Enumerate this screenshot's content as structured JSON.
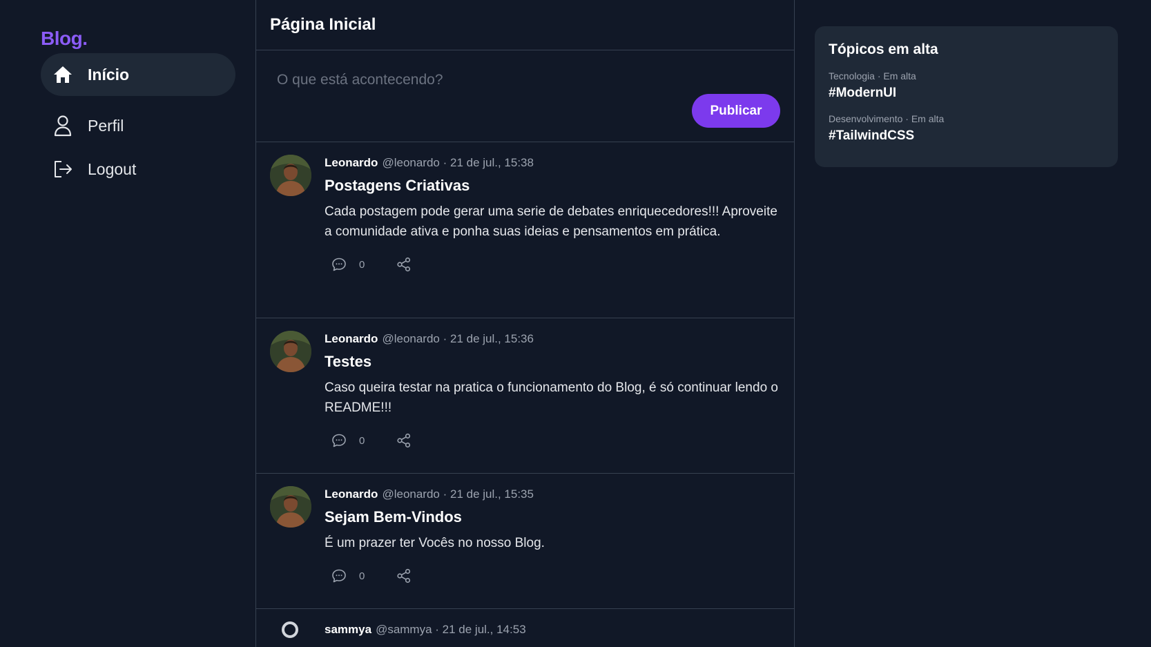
{
  "sidebar": {
    "logo": "Blog.",
    "items": [
      {
        "label": "Início",
        "icon": "home-icon",
        "active": true
      },
      {
        "label": "Perfil",
        "icon": "user-icon",
        "active": false
      },
      {
        "label": "Logout",
        "icon": "logout-icon",
        "active": false
      }
    ]
  },
  "main": {
    "title": "Página Inicial",
    "composer": {
      "placeholder": "O que está acontecendo?",
      "publish_label": "Publicar"
    },
    "posts": [
      {
        "author": "Leonardo",
        "handle": "@leonardo · 21 de jul., 15:38",
        "title": "Postagens Criativas",
        "body": "Cada postagem pode gerar uma serie de debates enriquecedores!!! Aproveite a comunidade ativa e ponha suas ideias e pensamentos em prática.",
        "comments": "0"
      },
      {
        "author": "Leonardo",
        "handle": "@leonardo · 21 de jul., 15:36",
        "title": "Testes",
        "body": "Caso queira testar na pratica o funcionamento do Blog, é só continuar lendo o README!!!",
        "comments": "0"
      },
      {
        "author": "Leonardo",
        "handle": "@leonardo · 21 de jul., 15:35",
        "title": "Sejam Bem-Vindos",
        "body": "É um prazer ter Vocês no nosso Blog.",
        "comments": "0"
      },
      {
        "author": "sammya",
        "handle": "@sammya · 21 de jul., 14:53"
      }
    ]
  },
  "trends": {
    "title": "Tópicos em alta",
    "items": [
      {
        "category": "Tecnologia · Em alta",
        "tag": "#ModernUI"
      },
      {
        "category": "Desenvolvimento · Em alta",
        "tag": "#TailwindCSS"
      }
    ]
  },
  "colors": {
    "background": "#111827",
    "card": "#1f2937",
    "accent": "#7c3aed",
    "logo": "#8b5cf6",
    "border": "#374151"
  }
}
